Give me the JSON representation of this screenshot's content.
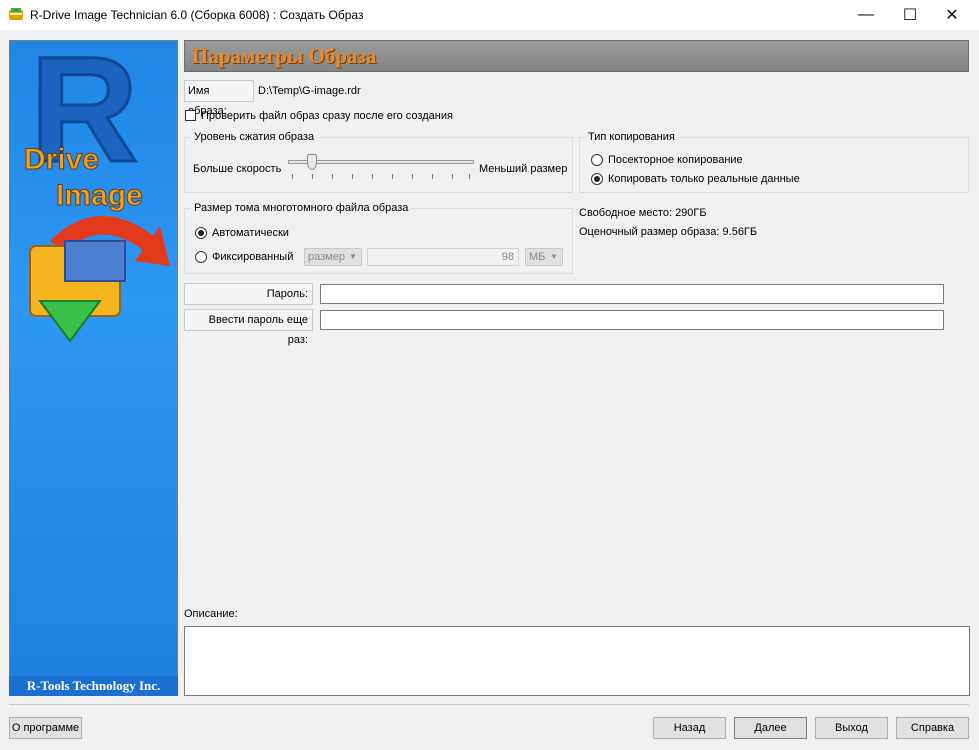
{
  "window": {
    "title": "R-Drive Image Technician 6.0 (Сборка 6008) : Создать Образ",
    "minimize_glyph": "—",
    "maximize_glyph": "☐",
    "close_glyph": "✕"
  },
  "banner": {
    "logo_letter": "R",
    "logo_word1": "Drive",
    "logo_word2": "Image",
    "company": "R-Tools Technology Inc."
  },
  "header": {
    "title": "Параметры Образа"
  },
  "image_name": {
    "label": "Имя образа:",
    "value": "D:\\Temp\\G-image.rdr"
  },
  "verify": {
    "label": "Проверить файл образ сразу после его создания",
    "checked": false
  },
  "compression": {
    "group_title": "Уровень сжатия образа",
    "left_label": "Больше скорость",
    "right_label": "Меньший размер",
    "level": 0.1
  },
  "copy_type": {
    "group_title": "Тип копирования",
    "options": [
      {
        "label": "Посекторное копирование",
        "selected": false
      },
      {
        "label": "Копировать только реальные данные",
        "selected": true
      }
    ]
  },
  "volume_size": {
    "group_title": "Размер тома многотомного файла образа",
    "auto_label": "Автоматически",
    "fixed_label": "Фиксированный",
    "size_combo": "размер",
    "size_value": "98",
    "unit_combo": "МБ"
  },
  "info": {
    "free_space": "Свободное место: 290ГБ",
    "estimated_size": "Оценочный размер образа: 9.56ГБ"
  },
  "password": {
    "label": "Пароль:",
    "confirm_label": "Ввести пароль еще раз:",
    "value": "",
    "confirm_value": ""
  },
  "description": {
    "label": "Описание:",
    "value": ""
  },
  "buttons": {
    "about": "О программе",
    "back": "Назад",
    "next": "Далее",
    "exit": "Выход",
    "help": "Справка"
  },
  "colors": {
    "banner_blue": "#1f86e6",
    "header_text": "#e8892b",
    "header_bg": "#8f8f8f"
  }
}
